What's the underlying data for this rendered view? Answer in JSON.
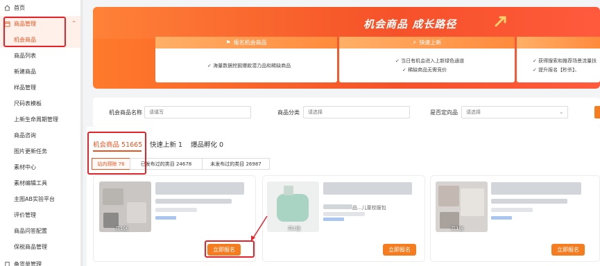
{
  "sidebar": {
    "home": "首页",
    "group": "商品管理",
    "items": [
      {
        "label": "机会商品",
        "active": true
      },
      {
        "label": "商品列表"
      },
      {
        "label": "新建商品"
      },
      {
        "label": "样品管理"
      },
      {
        "label": "尺码表模板"
      },
      {
        "label": "上新生命周期管理"
      },
      {
        "label": "商品咨询"
      },
      {
        "label": "图片更新任务"
      },
      {
        "label": "素材中心"
      },
      {
        "label": "素材编辑工具"
      },
      {
        "label": "主图AB实验平台"
      },
      {
        "label": "评价管理"
      },
      {
        "label": "商品问答配置"
      },
      {
        "label": "保税商品管理"
      },
      {
        "label": "备货单管理"
      }
    ]
  },
  "banner": {
    "title": "机会商品 成长路径",
    "steps": [
      {
        "head": "报名机会商品",
        "lines": [
          "海量数据挖掘爆款潜力品和稀缺商品"
        ]
      },
      {
        "head": "快速上新",
        "lines": [
          "当日有机会进入上新绿色通道",
          "稀缺商品无需竞价"
        ]
      },
      {
        "head": "",
        "lines": [
          "获得搜索和推荐场景流量扶",
          "提升报名【秒杀】、"
        ]
      }
    ]
  },
  "filter": {
    "name_label": "机会商品名称",
    "name_placeholder": "请填写",
    "category_label": "商品分类",
    "category_placeholder": "请选择",
    "fixed_label": "是否定向品",
    "fixed_placeholder": "请选择"
  },
  "tabs": [
    {
      "label": "机会商品 51665",
      "active": true
    },
    {
      "label": "快速上新 1"
    },
    {
      "label": "爆品孵化 0"
    }
  ],
  "subtabs": [
    {
      "label": "站内预除 76",
      "active": true
    },
    {
      "label": "已发布过的类目 24678"
    },
    {
      "label": "未发布过的类目 26987"
    }
  ],
  "cards": [
    {
      "badge": "共1张",
      "button": "立即报名"
    },
    {
      "badge": "共1张",
      "subtext": "品...儿童校服包",
      "button": "立即报名"
    },
    {
      "badge": "共1张",
      "button": "立即报名"
    }
  ],
  "colors": {
    "accent": "#f57d1f",
    "highlight": "#e5222a"
  }
}
